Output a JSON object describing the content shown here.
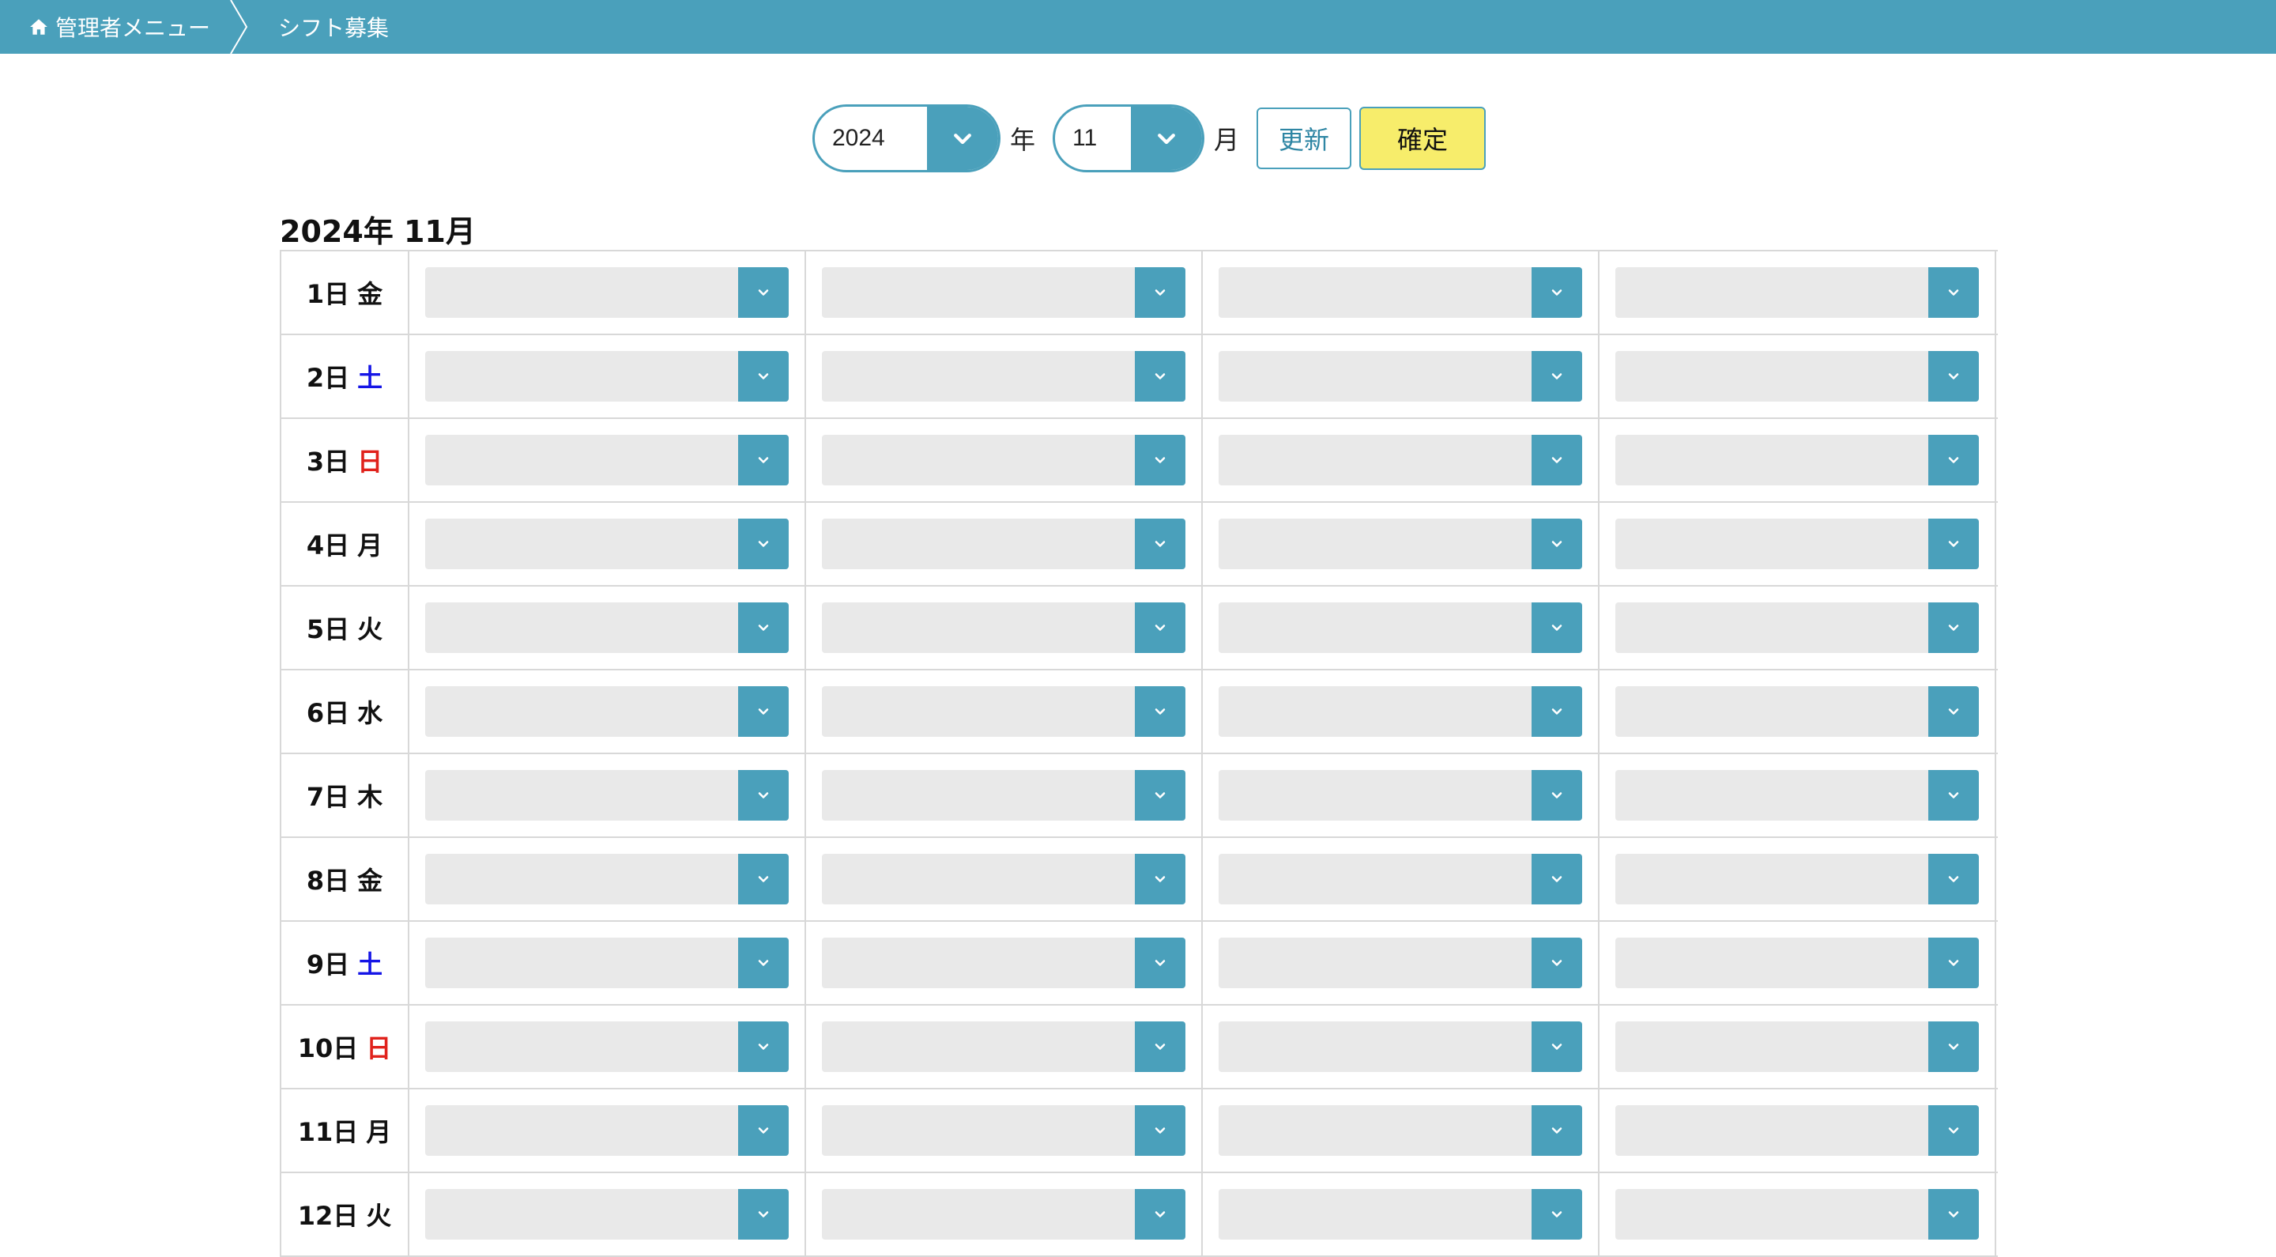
{
  "breadcrumb": {
    "home_label": "管理者メニュー",
    "current_label": "シフト募集"
  },
  "controls": {
    "year_value": "2024",
    "year_unit": "年",
    "month_value": "11",
    "month_unit": "月",
    "update_label": "更新",
    "confirm_label": "確定"
  },
  "heading": "2024年 11月",
  "colors": {
    "accent": "#4aa0bb",
    "confirm_bg": "#f7ed6b",
    "saturday": "#1515e6",
    "sunday": "#e0221c"
  },
  "rows": [
    {
      "day": "1日",
      "weekday": "金",
      "type": "weekday"
    },
    {
      "day": "2日",
      "weekday": "土",
      "type": "sat"
    },
    {
      "day": "3日",
      "weekday": "日",
      "type": "sun"
    },
    {
      "day": "4日",
      "weekday": "月",
      "type": "weekday"
    },
    {
      "day": "5日",
      "weekday": "火",
      "type": "weekday"
    },
    {
      "day": "6日",
      "weekday": "水",
      "type": "weekday"
    },
    {
      "day": "7日",
      "weekday": "木",
      "type": "weekday"
    },
    {
      "day": "8日",
      "weekday": "金",
      "type": "weekday"
    },
    {
      "day": "9日",
      "weekday": "土",
      "type": "sat"
    },
    {
      "day": "10日",
      "weekday": "日",
      "type": "sun"
    },
    {
      "day": "11日",
      "weekday": "月",
      "type": "weekday"
    },
    {
      "day": "12日",
      "weekday": "火",
      "type": "weekday"
    }
  ],
  "slot_values": [
    "",
    "",
    "",
    ""
  ],
  "icons": {
    "home": "home-icon",
    "dropdown": "chevron-down-icon"
  }
}
